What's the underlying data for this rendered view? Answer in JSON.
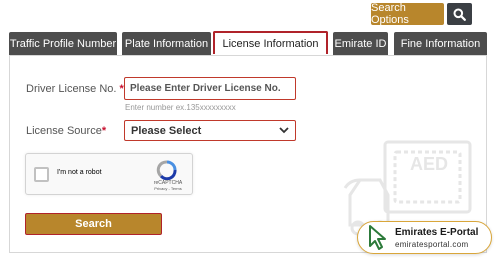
{
  "header": {
    "search_options_label": "Search Options",
    "search_icon": "search-icon"
  },
  "tabs": [
    {
      "label": "Traffic Profile Number"
    },
    {
      "label": "Plate Information"
    },
    {
      "label": "License Information",
      "active": true
    },
    {
      "label": "Emirate ID"
    },
    {
      "label": "Fine Information"
    }
  ],
  "form": {
    "license_no_label": "Driver License No.",
    "license_no_placeholder": "Please Enter Driver License No.",
    "license_no_value": "",
    "license_no_hint": "Enter number ex.135xxxxxxxxx",
    "license_source_label": "License Source",
    "license_source_selected": "Please Select",
    "required_mark": "*",
    "search_label": "Search"
  },
  "captcha": {
    "label": "I'm not a robot",
    "brand": "reCAPTCHA",
    "terms": "Privacy - Terms",
    "checked": false
  },
  "watermark": {
    "title": "Emirates E-Portal",
    "url": "emiratesportal.com"
  },
  "background": {
    "illustration_text": "AED"
  },
  "colors": {
    "accent": "#b8862c",
    "active_border": "#b0232a",
    "tab_bg": "#4d4d4d",
    "required": "#c8102e"
  }
}
